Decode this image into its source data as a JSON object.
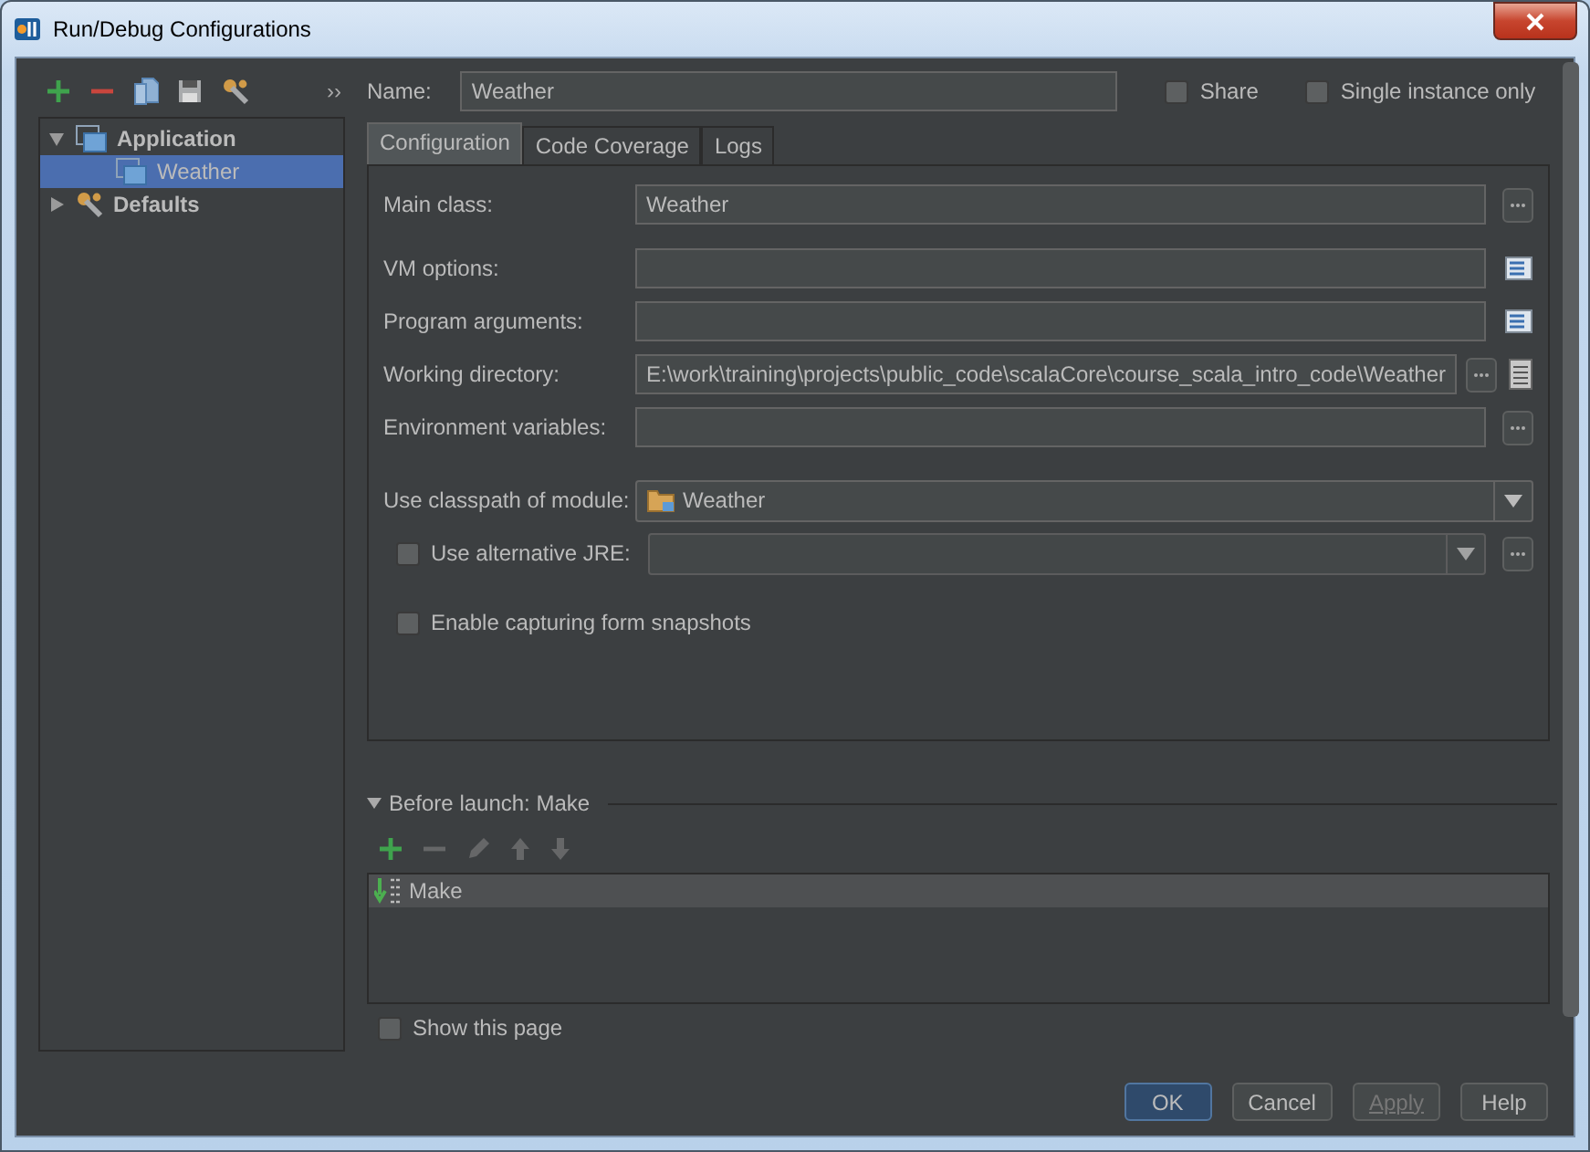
{
  "window": {
    "title": "Run/Debug Configurations"
  },
  "sidebar": {
    "toolbar": [
      {
        "kind": "add",
        "disabled": false
      },
      {
        "kind": "remove",
        "disabled": false
      },
      {
        "kind": "copy",
        "disabled": false
      },
      {
        "kind": "save",
        "disabled": false
      },
      {
        "kind": "wrench",
        "disabled": false
      }
    ],
    "more": "››",
    "tree": [
      {
        "label": "Application",
        "kind": "app",
        "expanded": true,
        "selected": false,
        "children": [
          {
            "label": "Weather",
            "kind": "app",
            "selected": true
          }
        ]
      },
      {
        "label": "Defaults",
        "kind": "wrench",
        "expanded": false,
        "selected": false
      }
    ]
  },
  "name": {
    "label": "Name:",
    "value": "Weather"
  },
  "options": [
    {
      "label": "Share",
      "checked": false
    },
    {
      "label": "Single instance only",
      "checked": false
    }
  ],
  "tabs": [
    {
      "label": "Configuration",
      "selected": true
    },
    {
      "label": "Code Coverage",
      "selected": false
    },
    {
      "label": "Logs",
      "selected": false
    }
  ],
  "fields": [
    {
      "label": "Main class:",
      "value": "Weather",
      "actions": [
        {
          "kind": "browse"
        }
      ]
    },
    {
      "label": "VM options:",
      "actions": [
        {
          "kind": "expand"
        }
      ]
    },
    {
      "label": "Program arguments:",
      "actions": [
        {
          "kind": "expand"
        }
      ]
    },
    {
      "label": "Working directory:",
      "value": "E:\\work\\training\\projects\\public_code\\scalaCore\\course_scala_intro_code\\Weather",
      "actions": [
        {
          "kind": "browse"
        },
        {
          "kind": "macro"
        }
      ]
    },
    {
      "label": "Environment variables:",
      "actions": [
        {
          "kind": "browse"
        }
      ]
    }
  ],
  "module": {
    "label": "Use classpath of module:",
    "value": "Weather"
  },
  "jre": {
    "label": "Use alternative JRE:",
    "checked": false
  },
  "snapshots": {
    "label": "Enable capturing form snapshots",
    "checked": false
  },
  "before_launch": {
    "title": "Before launch: Make",
    "expanded": true,
    "toolbar": [
      {
        "kind": "add",
        "disabled": false
      },
      {
        "kind": "remove",
        "disabled": true
      },
      {
        "kind": "edit",
        "disabled": true
      },
      {
        "kind": "up",
        "disabled": true
      },
      {
        "kind": "down",
        "disabled": true
      }
    ],
    "tasks": [
      {
        "label": "Make",
        "selected": true
      }
    ]
  },
  "show_page": {
    "label": "Show this page",
    "checked": false
  },
  "buttons": [
    {
      "label": "OK",
      "kind": "default",
      "disabled": false
    },
    {
      "label": "Cancel",
      "kind": "normal",
      "disabled": false
    },
    {
      "label": "Apply",
      "kind": "normal",
      "disabled": true
    },
    {
      "label": "Help",
      "kind": "normal",
      "disabled": false
    }
  ]
}
